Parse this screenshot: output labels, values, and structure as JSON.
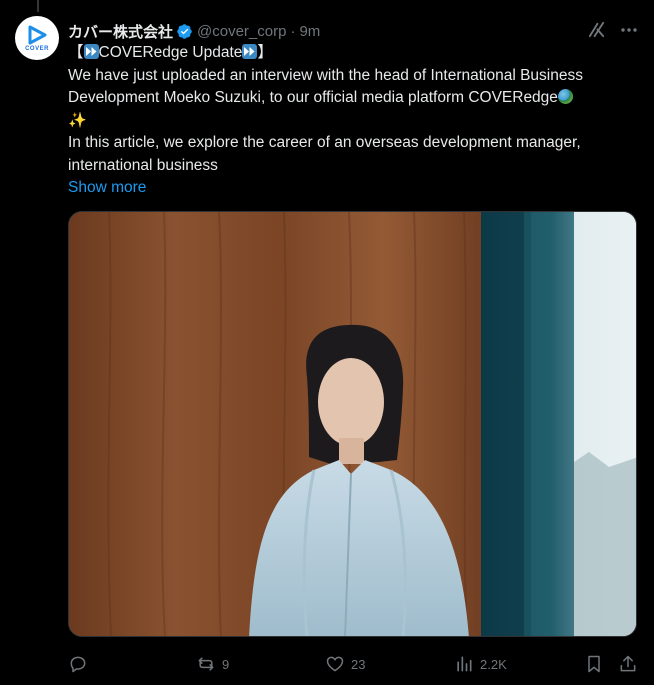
{
  "author": {
    "name": "カバー株式会社",
    "handle": "@cover_corp",
    "separator": "·",
    "time": "9m",
    "avatar_label": "COVER",
    "verified_color": "#1d9bf0"
  },
  "tweet": {
    "title_open": "【",
    "title_text": "COVERedge Update",
    "title_close": "】",
    "line1": "We have just uploaded an interview with the head of International Business",
    "line2": "Development  Moeko Suzuki, to our official media platform COVERedge",
    "line3": "In this article, we explore the career of an overseas development manager,",
    "line4": "international business",
    "show_more": "Show more"
  },
  "actions": {
    "reply_count": "",
    "retweet_count": "9",
    "like_count": "23",
    "views_count": "2.2K"
  },
  "icons": {
    "top": [
      "grok-icon",
      "more-icon"
    ],
    "actions": [
      "reply-icon",
      "retweet-icon",
      "like-icon",
      "views-icon",
      "bookmark-icon",
      "share-icon"
    ]
  },
  "colors": {
    "background": "#000000",
    "text": "#e7e9ea",
    "secondary": "#71767b",
    "link": "#1d9bf0"
  }
}
